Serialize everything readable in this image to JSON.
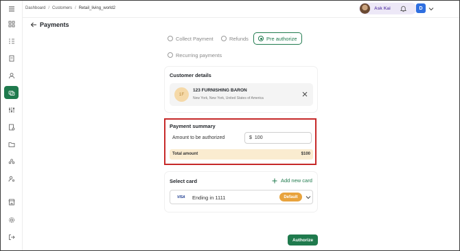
{
  "breadcrumb": [
    "Dashboard",
    "Customers",
    "Retail_living_world2"
  ],
  "header": {
    "ask_kai": "Ask Kai",
    "user_initial": "D"
  },
  "page": {
    "title": "Payments"
  },
  "payment_types": [
    {
      "label": "Collect Payment",
      "selected": false
    },
    {
      "label": "Refunds",
      "selected": false
    },
    {
      "label": "Pre authorize",
      "selected": true
    },
    {
      "label": "Recurring payments",
      "selected": false
    }
  ],
  "customer": {
    "section_title": "Customer details",
    "initials": "1F",
    "name": "123 FURNISHING BARON",
    "address": "New York, New York, United States of America"
  },
  "payment_summary": {
    "title": "Payment summary",
    "amount_label": "Amount to be authorized",
    "currency": "$",
    "amount": "100",
    "total_label": "Total amount",
    "total_value": "$100"
  },
  "select_card": {
    "title": "Select card",
    "add_label": "Add new card",
    "brand": "VISA",
    "ending": "Ending in 1111",
    "default_badge": "Default"
  },
  "actions": {
    "authorize": "Authorize"
  },
  "colors": {
    "primary": "#1f7a4d",
    "highlight_border": "#c62828",
    "total_bg": "#faecd0",
    "badge": "#e8a33d",
    "user_badge": "#2f6fe0"
  },
  "sidebar_icons": [
    "menu-icon",
    "dashboard-icon",
    "orders-icon",
    "invoice-icon",
    "customer-icon",
    "payments-icon",
    "settings-sliders-icon",
    "reports-icon",
    "folder-icon",
    "team-icon",
    "user-settings-icon",
    "store-icon",
    "gear-icon",
    "logout-icon"
  ]
}
